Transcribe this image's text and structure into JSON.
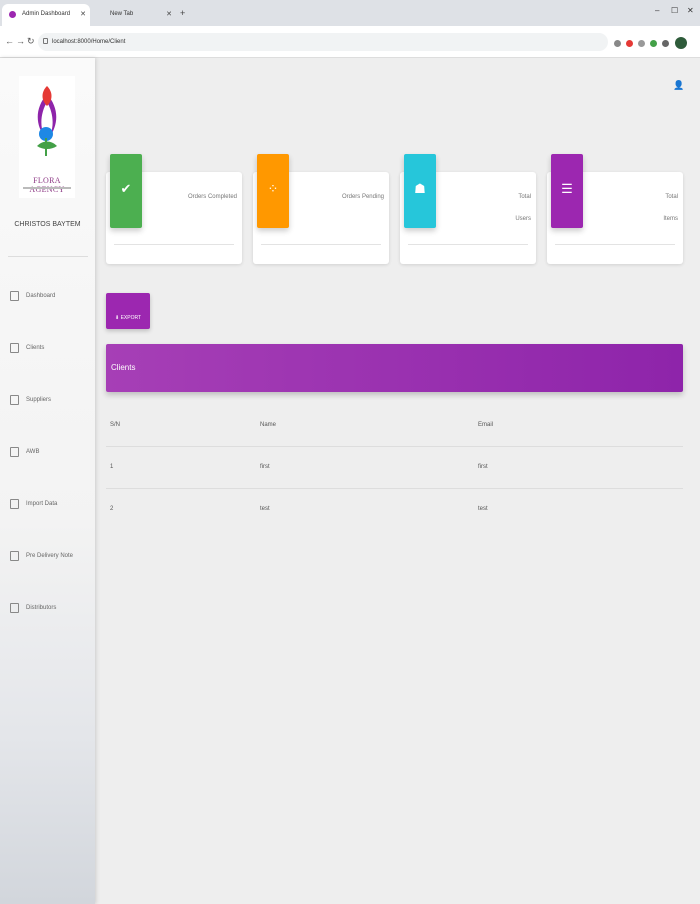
{
  "browser": {
    "tabs": [
      {
        "title": "Admin Dashboard",
        "active": true
      },
      {
        "title": "New Tab",
        "active": false
      }
    ],
    "url": "localhost:8000/Home/Client",
    "controls": {
      "minimize": "–",
      "maximize": "☐",
      "close": "✕",
      "new_tab": "+"
    }
  },
  "sidebar": {
    "logo_text": "FLORA AGENCY",
    "brand": "CHRISTOS BAYTEM",
    "items": [
      {
        "label": "Dashboard",
        "icon": "dashboard-icon"
      },
      {
        "label": "Clients",
        "icon": "clients-icon"
      },
      {
        "label": "Suppliers",
        "icon": "suppliers-icon"
      },
      {
        "label": "AWB",
        "icon": "awb-icon"
      },
      {
        "label": "Import Data",
        "icon": "import-icon"
      },
      {
        "label": "Pre Delivery Note",
        "icon": "delivery-note-icon"
      },
      {
        "label": "Distributors",
        "icon": "distributors-icon"
      }
    ]
  },
  "cards": [
    {
      "label": "Orders Completed",
      "color": "#4caf50",
      "icon": "check-circle-icon"
    },
    {
      "label": "Orders Pending",
      "color": "#ff9800",
      "icon": "spinner-icon"
    },
    {
      "label": "Total Users",
      "color": "#26c6da",
      "icon": "users-icon"
    },
    {
      "label": "Total Items",
      "color": "#9c27b0",
      "icon": "list-icon"
    }
  ],
  "export_label": "EXPORT",
  "clients_title": "Clients",
  "table": {
    "headers": [
      "S/N",
      "Name",
      "Email"
    ],
    "rows": [
      [
        "1",
        "first",
        "first"
      ],
      [
        "2",
        "test",
        "test"
      ]
    ]
  },
  "colors": {
    "accent": "#9c27b0"
  }
}
